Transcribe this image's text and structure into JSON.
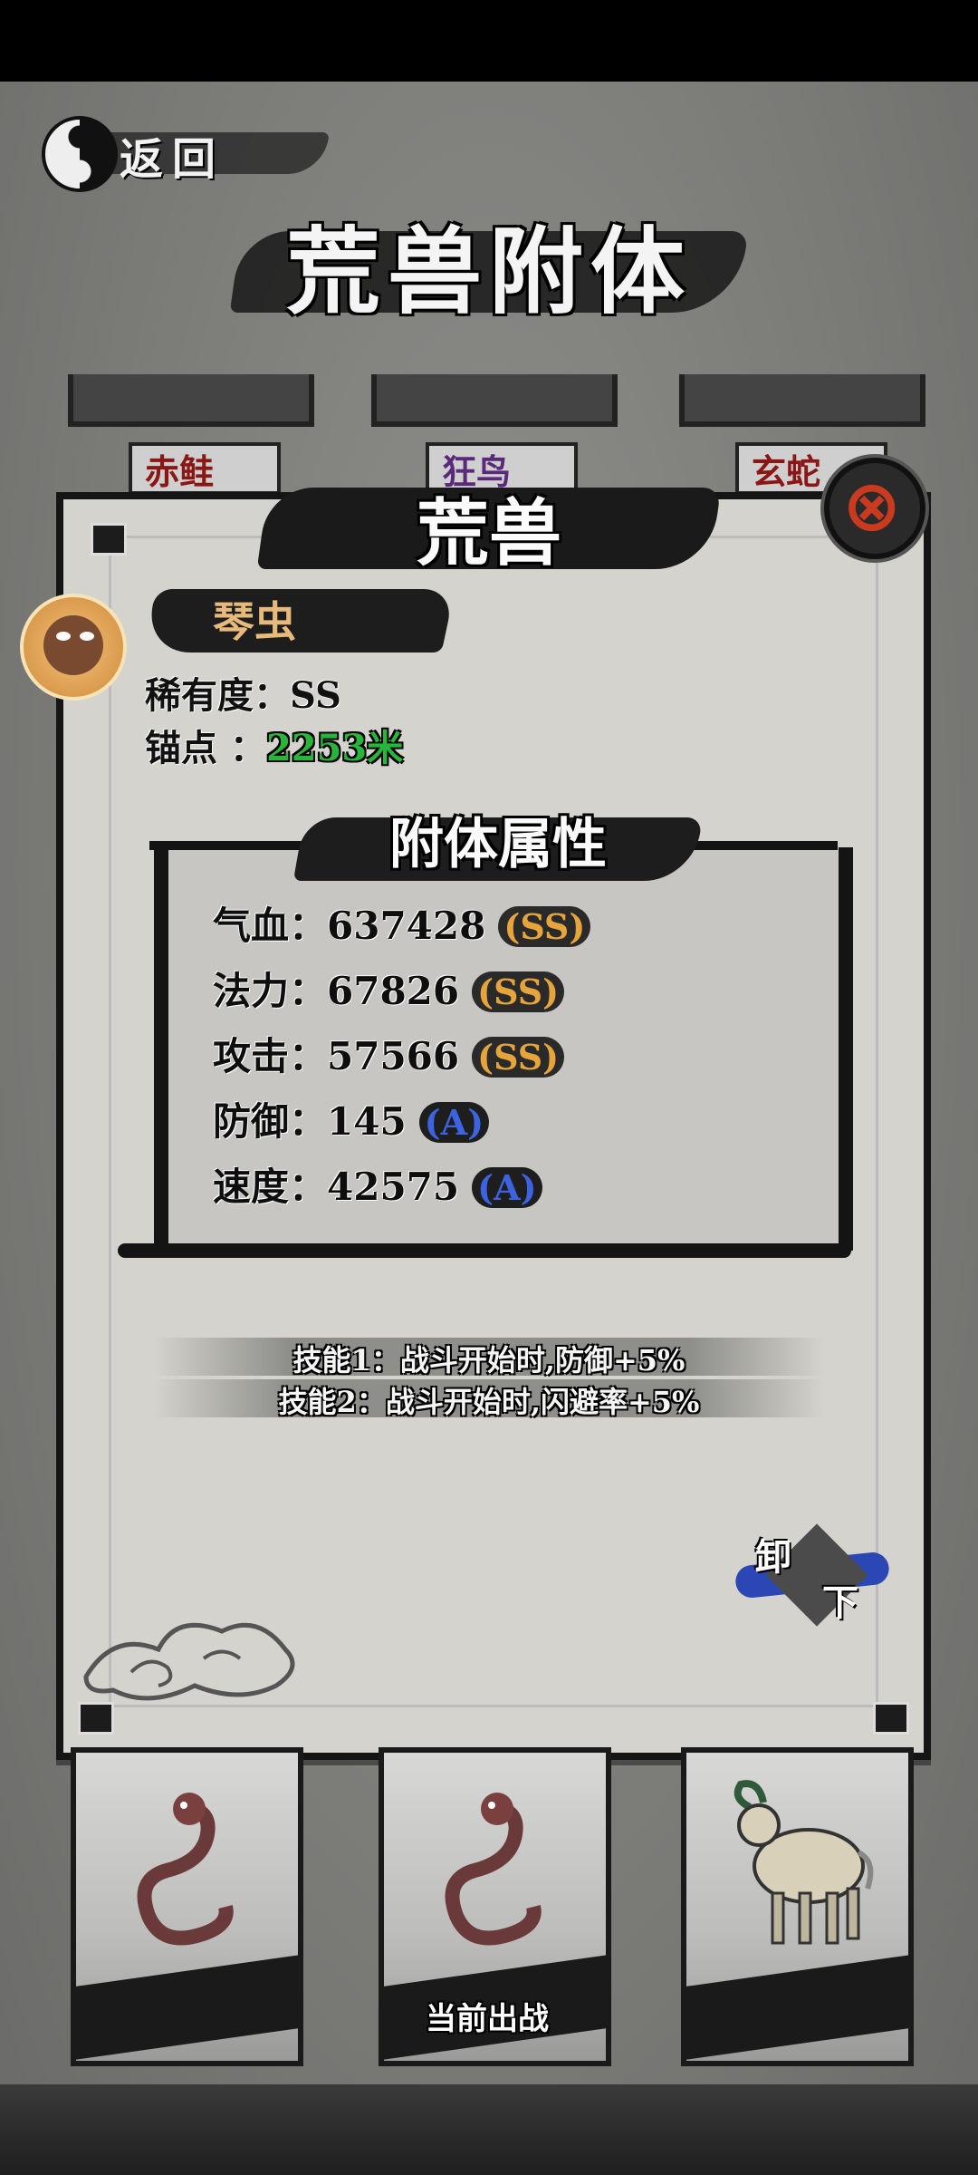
{
  "header": {
    "back_label": "返回",
    "title": "荒兽附体"
  },
  "tabs": [
    {
      "label": "赤鲑"
    },
    {
      "label": "狂鸟"
    },
    {
      "label": "玄蛇"
    }
  ],
  "dialog": {
    "title": "荒兽",
    "beast_name": "琴虫",
    "rarity_label": "稀有度：SS",
    "anchor_label": "锚点 ：",
    "anchor_value": "2253米",
    "attributes_title": "附体属性",
    "attributes": [
      {
        "label": "气血：637428",
        "grade": "(SS)"
      },
      {
        "label": "法力：67826",
        "grade": "(SS)"
      },
      {
        "label": "攻击：57566",
        "grade": "(SS)"
      },
      {
        "label": "防御：145",
        "grade": "(A)"
      },
      {
        "label": "速度：42575",
        "grade": "(A)"
      }
    ],
    "skills": [
      "技能1：战斗开始时,防御+5%",
      "技能2：战斗开始时,闪避率+5%"
    ],
    "unequip_label_1": "卸",
    "unequip_label_2": "下"
  },
  "cards": {
    "current_label": "当前出战"
  },
  "colors": {
    "grade_ss": "#e5a43c",
    "grade_a": "#3e63e0",
    "anchor_green": "#27b53a",
    "tab_red": "#8a1616"
  }
}
